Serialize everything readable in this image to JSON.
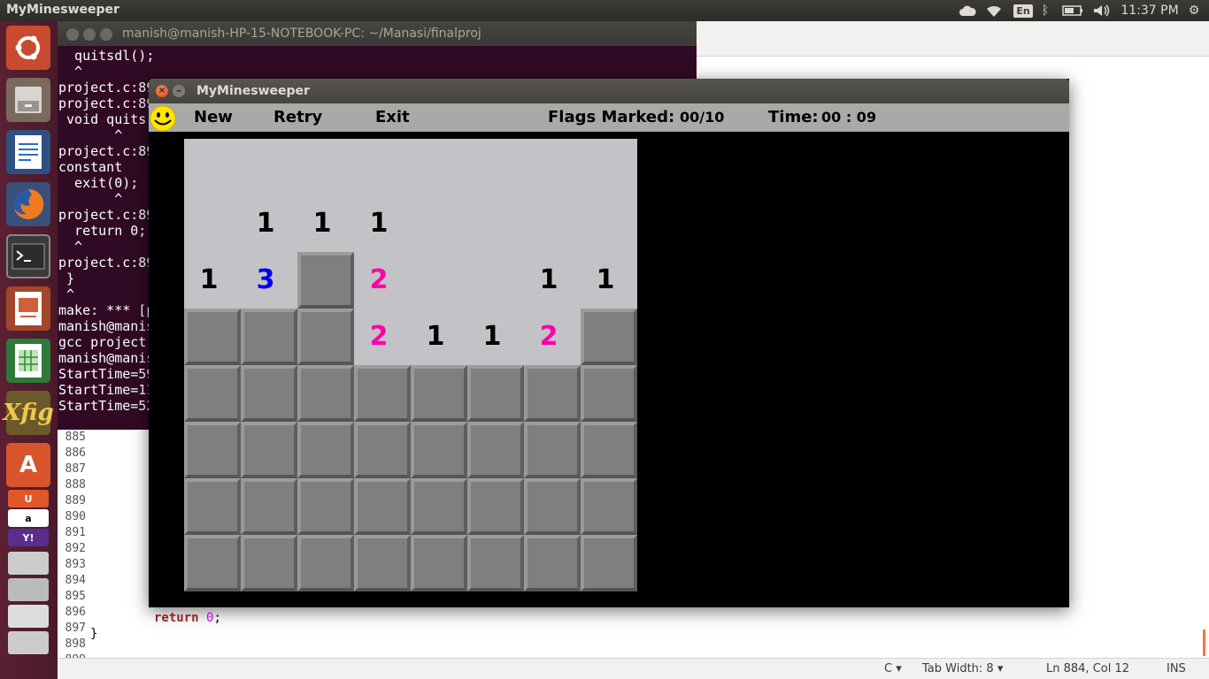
{
  "top_panel": {
    "app_title": "MyMinesweeper",
    "keyboard_layout": "En",
    "clock": "11:37 PM"
  },
  "launcher": {
    "items": [
      "ubuntu-dash",
      "files",
      "libreoffice-writer",
      "firefox",
      "terminal",
      "libreoffice-impress",
      "libreoffice-calc",
      "xfig",
      "ubuntu-software-center",
      "ubuntu-one",
      "amazon",
      "yahoo-mail",
      "workspace-switcher",
      "trash"
    ],
    "xfig_label": "Xfig",
    "amazon_label": "a",
    "yahoo_label": "Y!",
    "software_center_label": "A"
  },
  "terminal": {
    "title": "manish@manish-HP-15-NOTEBOOK-PC: ~/Manasi/finalproj",
    "lines": [
      "  quitsdl();",
      "  ^",
      "project.c:89",
      "project.c:89",
      " void quits",
      "       ^",
      "project.c:89",
      "constant",
      "  exit(0);",
      "       ^",
      "project.c:89",
      "  return 0;",
      "  ^",
      "project.c:89",
      " }",
      " ^",
      "make: *** [p",
      "manish@manis",
      "gcc project",
      "manish@manis",
      "StartTime=59",
      "StartTime=11",
      "StartTime=52"
    ]
  },
  "editor": {
    "line_numbers": [
      "885",
      "886",
      "887",
      "888",
      "889",
      "890",
      "891",
      "892",
      "893",
      "894",
      "895",
      "896",
      "897",
      "898",
      "899"
    ],
    "code_return_keyword": "return",
    "code_return_value": "0",
    "code_return_end": ";",
    "code_closing_brace": "}",
    "status": {
      "language": "C ▾",
      "tab_width": "Tab Width: 8 ▾",
      "cursor": "Ln 884, Col 12",
      "mode": "INS"
    }
  },
  "minesweeper": {
    "window_title": "MyMinesweeper",
    "menu": {
      "new": "New",
      "retry": "Retry",
      "exit": "Exit"
    },
    "flags_label": "Flags Marked:",
    "flags_value": "00/10",
    "time_label": "Time:",
    "time_value": "00 : 09",
    "colors": {
      "num_black": "#000000",
      "num_blue": "#0000ee",
      "num_magenta": "#ff00aa"
    },
    "board": {
      "rows": 8,
      "cols": 8,
      "cells": [
        [
          "",
          "",
          "",
          "",
          "",
          "",
          "",
          ""
        ],
        [
          "",
          "1",
          "1",
          "1",
          "",
          "",
          "",
          ""
        ],
        [
          "1",
          "3",
          "#",
          "2",
          "",
          "",
          "1",
          "1"
        ],
        [
          "#",
          "#",
          "#",
          "2",
          "1",
          "1",
          "2",
          "#"
        ],
        [
          "#",
          "#",
          "#",
          "#",
          "#",
          "#",
          "#",
          "#"
        ],
        [
          "#",
          "#",
          "#",
          "#",
          "#",
          "#",
          "#",
          "#"
        ],
        [
          "#",
          "#",
          "#",
          "#",
          "#",
          "#",
          "#",
          "#"
        ],
        [
          "#",
          "#",
          "#",
          "#",
          "#",
          "#",
          "#",
          "#"
        ]
      ]
    }
  }
}
